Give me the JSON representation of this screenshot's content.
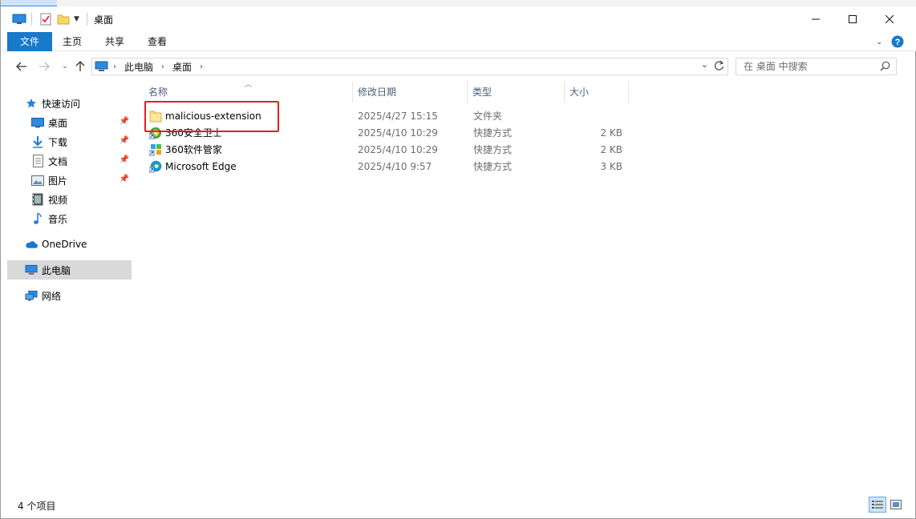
{
  "window": {
    "title": "桌面"
  },
  "ribbon": {
    "tabs": [
      {
        "label": "文件"
      },
      {
        "label": "主页"
      },
      {
        "label": "共享"
      },
      {
        "label": "查看"
      }
    ]
  },
  "address": {
    "breadcrumbs": [
      "此电脑",
      "桌面"
    ]
  },
  "search": {
    "placeholder": "在 桌面 中搜索"
  },
  "navpane": {
    "quick_access": "快速访问",
    "items": [
      {
        "label": "桌面",
        "icon": "desktop-icon",
        "pinned": true
      },
      {
        "label": "下载",
        "icon": "download-icon",
        "pinned": true
      },
      {
        "label": "文档",
        "icon": "documents-icon",
        "pinned": true
      },
      {
        "label": "图片",
        "icon": "pictures-icon",
        "pinned": true
      },
      {
        "label": "视频",
        "icon": "videos-icon",
        "pinned": false
      },
      {
        "label": "音乐",
        "icon": "music-icon",
        "pinned": false
      }
    ],
    "onedrive": "OneDrive",
    "this_pc": "此电脑",
    "network": "网络"
  },
  "columns": {
    "name": "名称",
    "modified": "修改日期",
    "type": "类型",
    "size": "大小"
  },
  "files": [
    {
      "name": "malicious-extension",
      "modified": "2025/4/27 15:15",
      "type": "文件夹",
      "size": "",
      "icon": "folder-icon"
    },
    {
      "name": "360安全卫士",
      "modified": "2025/4/10 10:29",
      "type": "快捷方式",
      "size": "2 KB",
      "icon": "360-security-icon"
    },
    {
      "name": "360软件管家",
      "modified": "2025/4/10 10:29",
      "type": "快捷方式",
      "size": "2 KB",
      "icon": "360-software-manager-icon"
    },
    {
      "name": "Microsoft Edge",
      "modified": "2025/4/10 9:57",
      "type": "快捷方式",
      "size": "3 KB",
      "icon": "edge-icon"
    }
  ],
  "status": {
    "item_count": "4 个项目"
  },
  "colors": {
    "accent": "#1979ca",
    "highlight_box": "#e02020",
    "selected_nav": "#d9d9d9"
  }
}
